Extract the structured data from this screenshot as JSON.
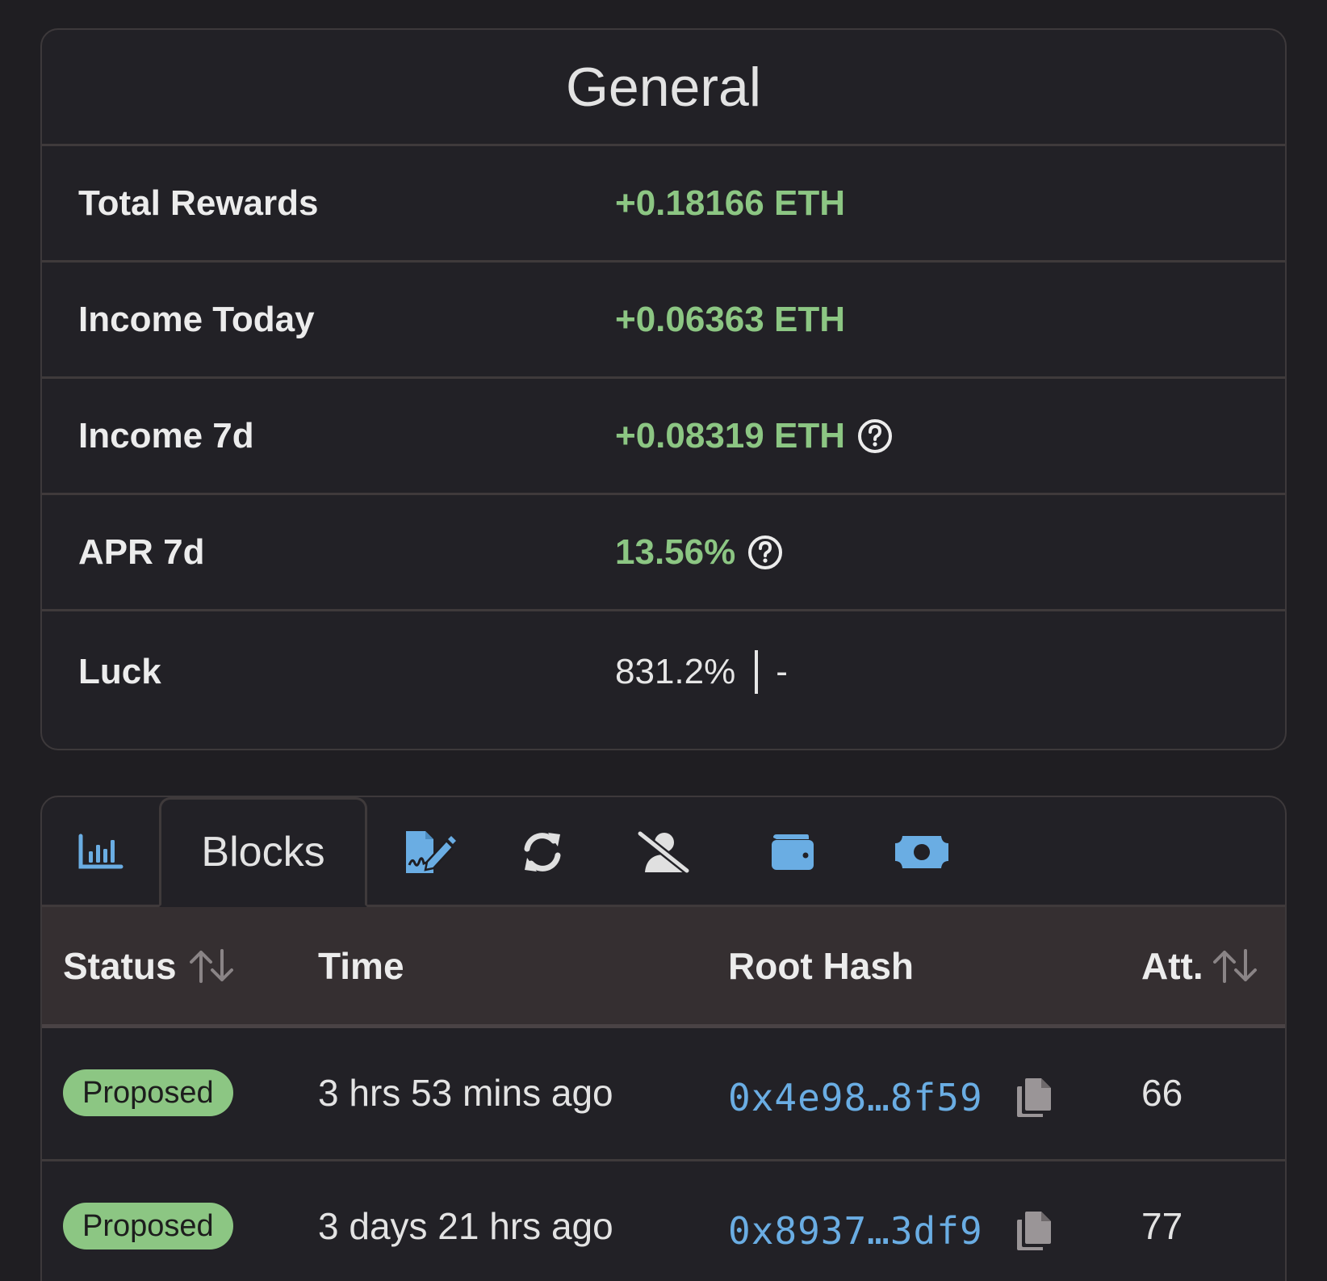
{
  "general": {
    "title": "General",
    "rows": [
      {
        "label": "Total Rewards",
        "value": "+0.18166 ETH"
      },
      {
        "label": "Income Today",
        "value": "+0.06363 ETH"
      },
      {
        "label": "Income 7d",
        "value": "+0.08319 ETH",
        "help_icon": "question-circle-icon"
      },
      {
        "label": "APR 7d",
        "value": "13.56%",
        "help_icon": "question-circle-icon"
      },
      {
        "label": "Luck",
        "value": "831.2%",
        "value_secondary": "-"
      }
    ],
    "colors": {
      "positive": "#8cc683"
    }
  },
  "tabs": {
    "items": [
      {
        "icon": "bar-chart-icon"
      },
      {
        "label": "Blocks",
        "active": true
      },
      {
        "icon": "signature-icon"
      },
      {
        "icon": "sync-icon"
      },
      {
        "icon": "user-slash-icon"
      },
      {
        "icon": "wallet-icon"
      },
      {
        "icon": "money-bill-icon"
      }
    ],
    "accent": "#6aade3"
  },
  "table": {
    "headers": {
      "status": "Status",
      "time": "Time",
      "root_hash": "Root Hash",
      "att": "Att."
    },
    "rows": [
      {
        "status": "Proposed",
        "time": "3 hrs 53 mins ago",
        "root_hash": "0x4e98…8f59",
        "att": "66"
      },
      {
        "status": "Proposed",
        "time": "3 days 21 hrs ago",
        "root_hash": "0x8937…3df9",
        "att": "77"
      }
    ]
  }
}
